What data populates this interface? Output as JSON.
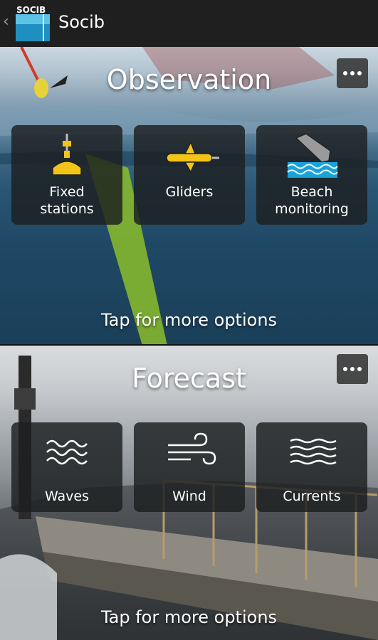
{
  "actionbar": {
    "title": "Socib",
    "logo_text": "SOCIB",
    "back_icon": "chevron-left-icon"
  },
  "observation": {
    "title": "Observation",
    "more_icon": "overflow-menu-icon",
    "tiles": [
      {
        "label_line1": "Fixed",
        "label_line2": "stations",
        "icon": "buoy-icon"
      },
      {
        "label_line1": "Gliders",
        "label_line2": "",
        "icon": "glider-icon"
      },
      {
        "label_line1": "Beach",
        "label_line2": "monitoring",
        "icon": "beach-camera-icon"
      }
    ],
    "hint": "Tap for more options"
  },
  "forecast": {
    "title": "Forecast",
    "more_icon": "overflow-menu-icon",
    "tiles": [
      {
        "label": "Waves",
        "icon": "waves-icon"
      },
      {
        "label": "Wind",
        "icon": "wind-icon"
      },
      {
        "label": "Currents",
        "icon": "currents-icon"
      }
    ],
    "hint": "Tap for more options"
  },
  "colors": {
    "actionbar_bg": "#1f1f1f",
    "tile_bg": "rgba(28,30,32,0.82)",
    "icon_yellow": "#f2c418",
    "icon_blue": "#1aa3d9"
  }
}
